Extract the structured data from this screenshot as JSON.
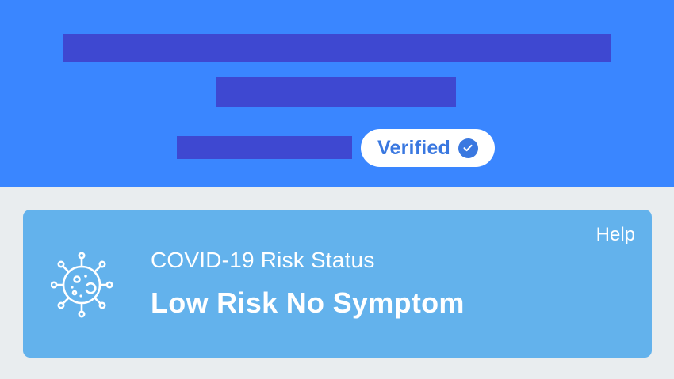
{
  "header": {
    "verified_label": "Verified",
    "verified_icon": "check-circle-icon",
    "background_color": "#3a86ff"
  },
  "status_card": {
    "help_label": "Help",
    "subtitle": "COVID-19 Risk Status",
    "status": "Low Risk No Symptom",
    "icon": "virus-icon",
    "background_color": "#63b2ec"
  }
}
